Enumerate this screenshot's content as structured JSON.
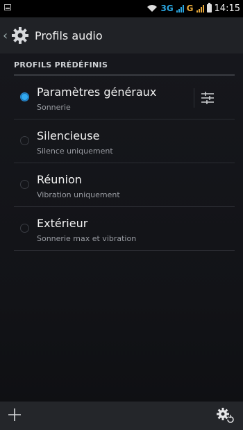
{
  "status_bar": {
    "network_label": "3G",
    "signal_label": "G",
    "time": "14:15"
  },
  "action_bar": {
    "title": "Profils audio",
    "back_icon": "chevron-left-icon",
    "app_icon": "gear-icon"
  },
  "section": {
    "header": "PROFILS PRÉDÉFINIS"
  },
  "profiles": [
    {
      "title": "Paramètres généraux",
      "subtitle": "Sonnerie",
      "selected": true,
      "has_settings": true
    },
    {
      "title": "Silencieuse",
      "subtitle": "Silence uniquement",
      "selected": false,
      "has_settings": false
    },
    {
      "title": "Réunion",
      "subtitle": "Vibration uniquement",
      "selected": false,
      "has_settings": false
    },
    {
      "title": "Extérieur",
      "subtitle": "Sonnerie max et vibration",
      "selected": false,
      "has_settings": false
    }
  ],
  "bottom_bar": {
    "left_icon": "add-icon",
    "right_icon": "gear-refresh-icon"
  },
  "colors": {
    "accent": "#33aaf0",
    "network": "#2aa6e0",
    "signal_alt": "#e8a93a"
  }
}
